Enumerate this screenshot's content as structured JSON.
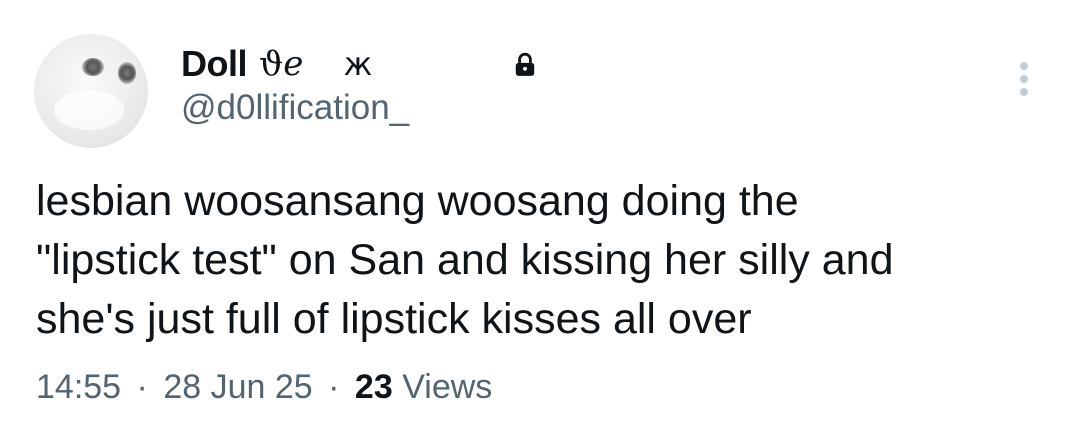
{
  "author": {
    "display_name": "Doll",
    "name_symbol_1": "ϑℯ",
    "name_symbol_2": "ж",
    "handle": "@d0llification_",
    "protected_icon": "lock-icon",
    "avatar_icon": "avatar"
  },
  "menu": {
    "more_icon": "more-vertical-icon"
  },
  "tweet": {
    "lines": [
      "lesbian woosansang woosang doing the",
      "\"lipstick test\" on San and kissing her silly and",
      "she's just full of lipstick kisses all over"
    ]
  },
  "meta": {
    "time": "14:55",
    "separator": "·",
    "date": "28 Jun 25",
    "views_count": "23",
    "views_label": "Views"
  }
}
